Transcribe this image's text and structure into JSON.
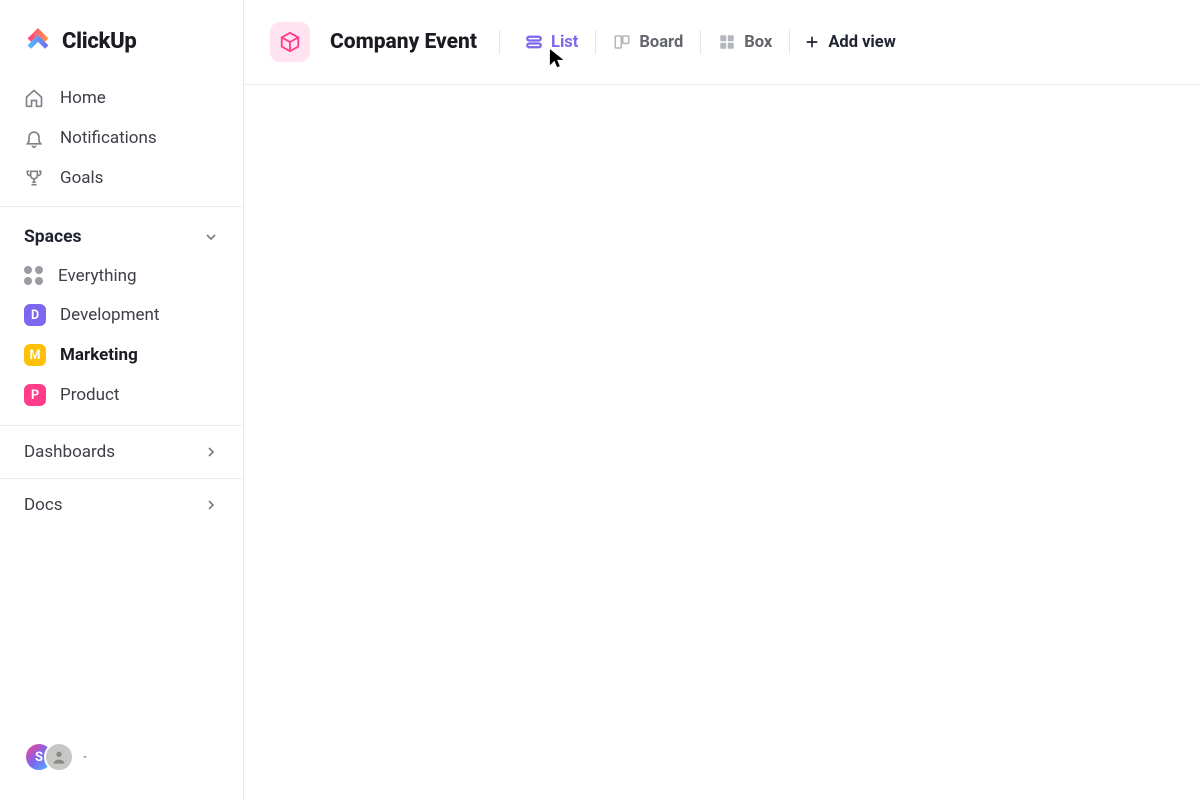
{
  "brand": {
    "name": "ClickUp"
  },
  "sidebar": {
    "nav": [
      {
        "label": "Home"
      },
      {
        "label": "Notifications"
      },
      {
        "label": "Goals"
      }
    ],
    "spaces_header": "Spaces",
    "everything_label": "Everything",
    "spaces": [
      {
        "letter": "D",
        "label": "Development"
      },
      {
        "letter": "M",
        "label": "Marketing"
      },
      {
        "letter": "P",
        "label": "Product"
      }
    ],
    "dashboards_label": "Dashboards",
    "docs_label": "Docs",
    "avatar_initial": "S"
  },
  "header": {
    "title": "Company Event",
    "views": [
      {
        "label": "List"
      },
      {
        "label": "Board"
      },
      {
        "label": "Box"
      }
    ],
    "add_view_label": "Add view"
  }
}
